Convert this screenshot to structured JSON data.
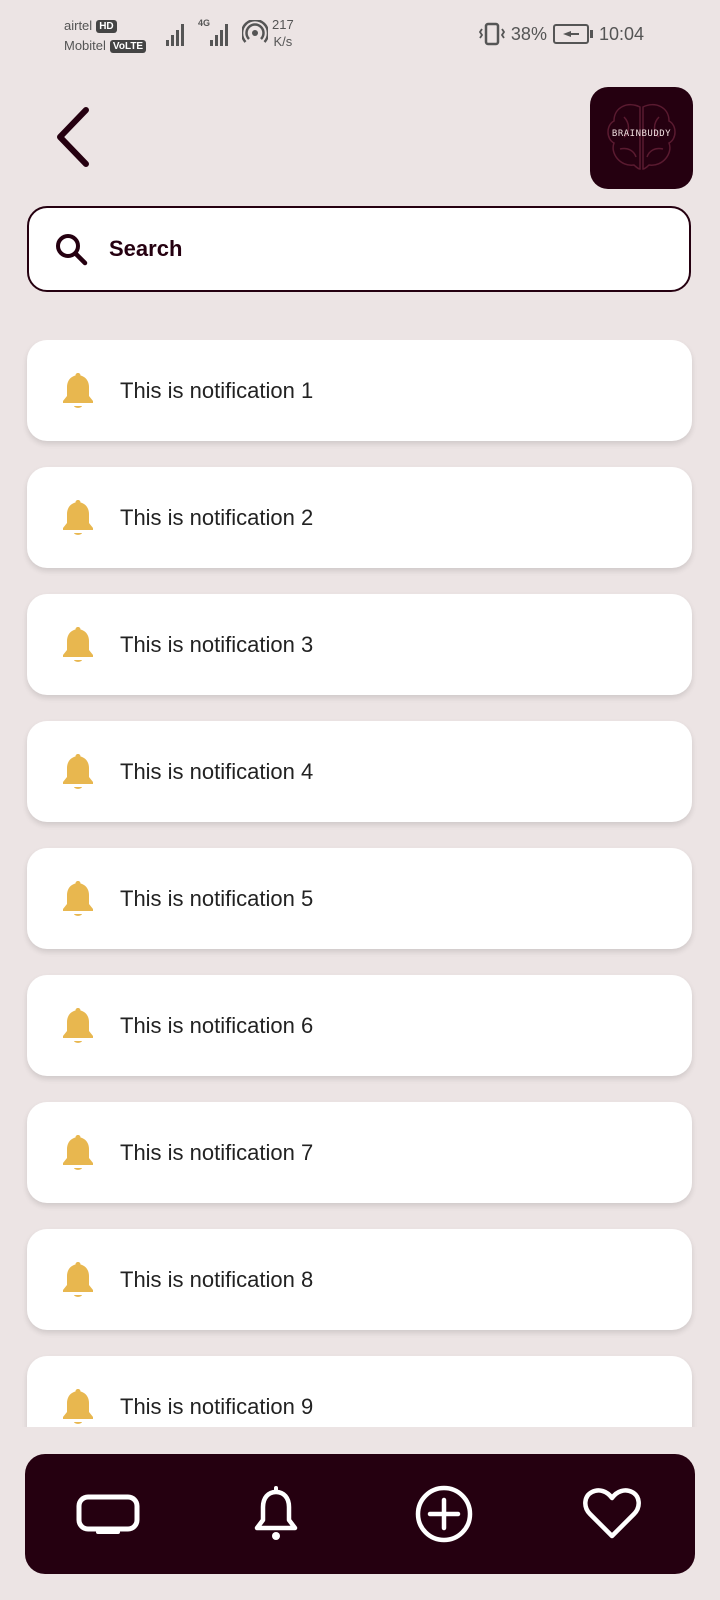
{
  "status_bar": {
    "carrier1": "airtel",
    "carrier1_badge": "HD",
    "carrier2": "Mobitel",
    "carrier2_badge": "VoLTE",
    "network_type": "4G",
    "net_speed_value": "217",
    "net_speed_unit": "K/s",
    "battery": "38%",
    "time": "10:04"
  },
  "header": {
    "back_icon": "chevron-left-icon",
    "logo_text": "BRAINBUDDY"
  },
  "search": {
    "placeholder": "Search",
    "value": ""
  },
  "notifications": [
    {
      "text": "This is notification 1",
      "icon": "bell-icon"
    },
    {
      "text": "This is notification 2",
      "icon": "bell-icon"
    },
    {
      "text": "This is notification 3",
      "icon": "bell-icon"
    },
    {
      "text": "This is notification 4",
      "icon": "bell-icon"
    },
    {
      "text": "This is notification 5",
      "icon": "bell-icon"
    },
    {
      "text": "This is notification 6",
      "icon": "bell-icon"
    },
    {
      "text": "This is notification 7",
      "icon": "bell-icon"
    },
    {
      "text": "This is notification 8",
      "icon": "bell-icon"
    },
    {
      "text": "This is notification 9",
      "icon": "bell-icon"
    }
  ],
  "bottom_nav": [
    {
      "icon": "tv-icon"
    },
    {
      "icon": "bell-icon"
    },
    {
      "icon": "plus-circle-icon"
    },
    {
      "icon": "heart-icon"
    }
  ],
  "colors": {
    "accent_dark": "#250010",
    "bell": "#e8b74f",
    "background": "#ece4e4",
    "card": "#ffffff"
  }
}
